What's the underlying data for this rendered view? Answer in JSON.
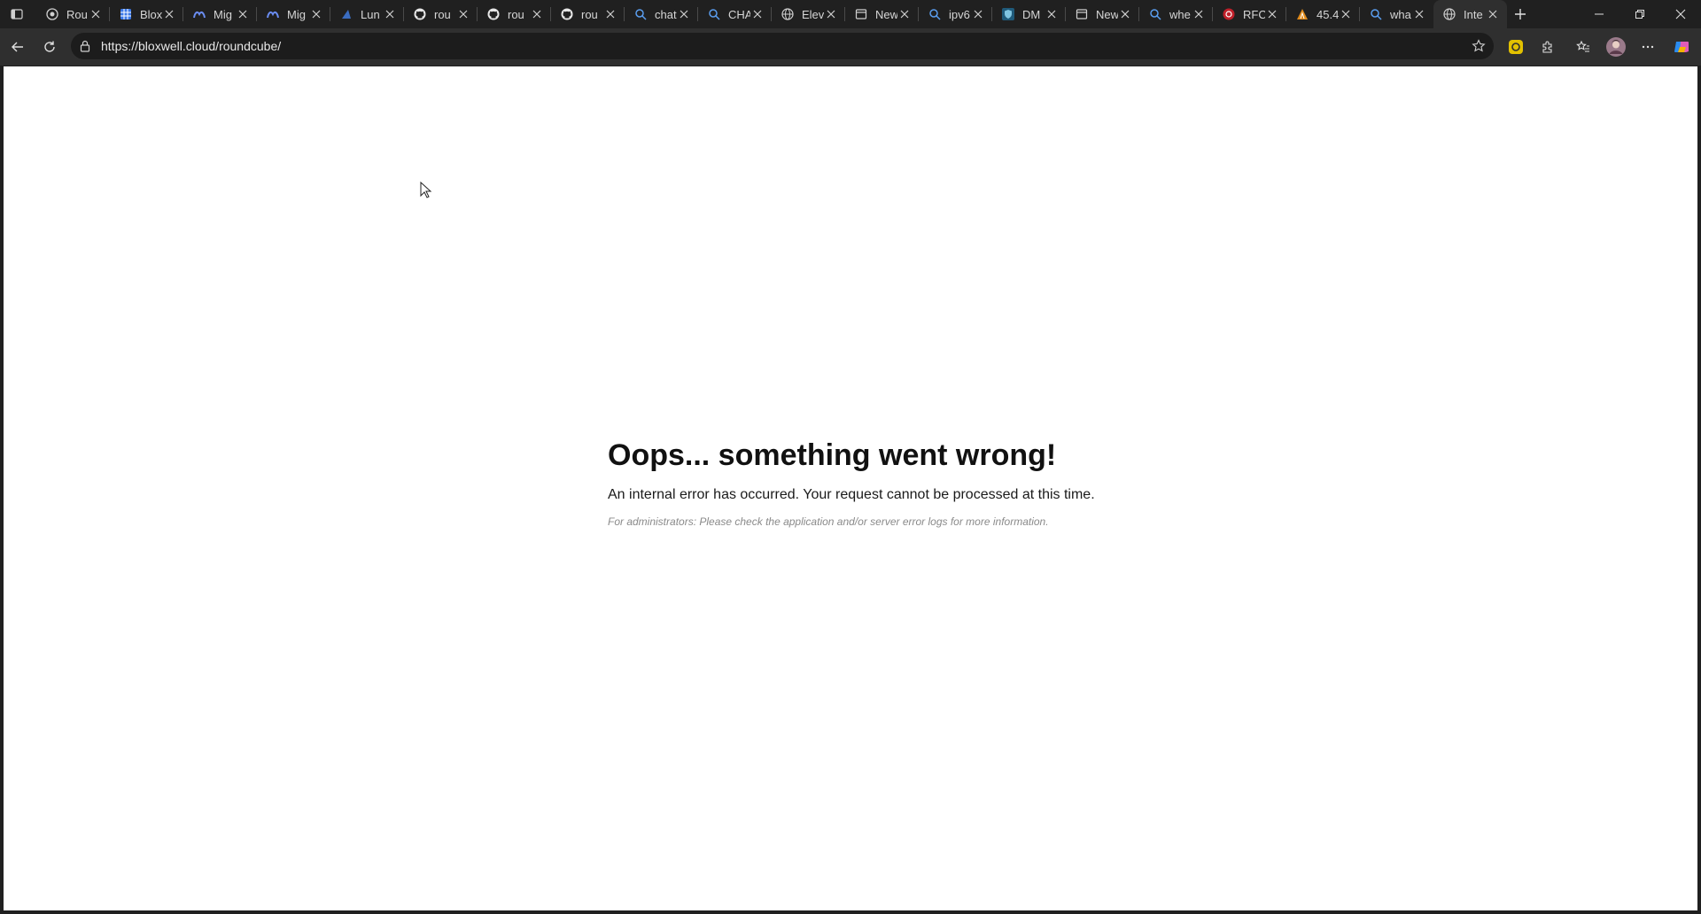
{
  "browser": {
    "tabs": [
      {
        "title": "Rou",
        "icon": "roundcube-icon",
        "active": false
      },
      {
        "title": "Blox",
        "icon": "spreadsheet-icon",
        "active": false
      },
      {
        "title": "Mig",
        "icon": "mig-icon",
        "active": false
      },
      {
        "title": "Mig",
        "icon": "mig-icon",
        "active": false
      },
      {
        "title": "Lun",
        "icon": "lunar-icon",
        "active": false
      },
      {
        "title": "rou",
        "icon": "github-icon",
        "active": false
      },
      {
        "title": "rou",
        "icon": "github-icon",
        "active": false
      },
      {
        "title": "rou",
        "icon": "github-icon",
        "active": false
      },
      {
        "title": "chat",
        "icon": "search-icon",
        "active": false
      },
      {
        "title": "CHA",
        "icon": "search-icon",
        "active": false
      },
      {
        "title": "Elev",
        "icon": "globe-icon",
        "active": false
      },
      {
        "title": "New",
        "icon": "page-icon",
        "active": false
      },
      {
        "title": "ipv6",
        "icon": "search-icon",
        "active": false
      },
      {
        "title": "DM",
        "icon": "shield-icon",
        "active": false
      },
      {
        "title": "New",
        "icon": "page-icon",
        "active": false
      },
      {
        "title": "whe",
        "icon": "search-icon",
        "active": false
      },
      {
        "title": "RFC",
        "icon": "rfc-icon",
        "active": false
      },
      {
        "title": "45.4",
        "icon": "warning-icon",
        "active": false
      },
      {
        "title": "wha",
        "icon": "search-icon",
        "active": false
      },
      {
        "title": "Inte",
        "icon": "globe-icon",
        "active": true
      }
    ],
    "address": {
      "url": "https://bloxwell.cloud/roundcube/"
    }
  },
  "page": {
    "title": "Oops... something went wrong!",
    "message": "An internal error has occurred. Your request cannot be processed at this time.",
    "admin_note": "For administrators: Please check the application and/or server error logs for more information."
  }
}
